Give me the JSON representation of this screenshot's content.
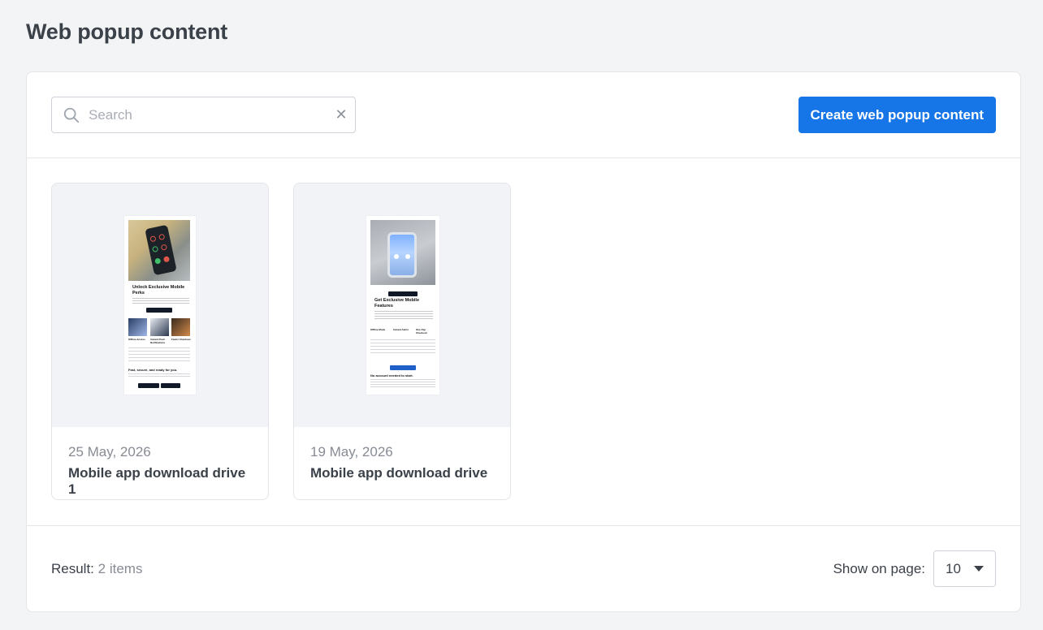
{
  "page": {
    "title": "Web popup content"
  },
  "toolbar": {
    "search_placeholder": "Search",
    "clear_glyph": "✕",
    "create_label": "Create web popup content"
  },
  "cards": [
    {
      "date": "25 May, 2026",
      "title": "Mobile app download drive 1",
      "preview": {
        "heading": "Unlock Exclusive Mobile Perks",
        "columns": [
          "Offline Access",
          "Instant Push Notifications",
          "Faster Checkout"
        ],
        "subheading": "Fast, secure, and ready for you."
      }
    },
    {
      "date": "19 May, 2026",
      "title": "Mobile app download drive",
      "preview": {
        "heading": "Get Exclusive Mobile Features",
        "columns": [
          "Offline Mode",
          "Instant Alerts",
          "One-Tap Checkout"
        ],
        "subheading": "No account needed to start."
      }
    }
  ],
  "footer": {
    "result_label": "Result:",
    "result_count": "2 items",
    "show_label": "Show on page:",
    "page_size": "10"
  },
  "colors": {
    "accent": "#1676e8",
    "background": "#f3f4f6"
  }
}
